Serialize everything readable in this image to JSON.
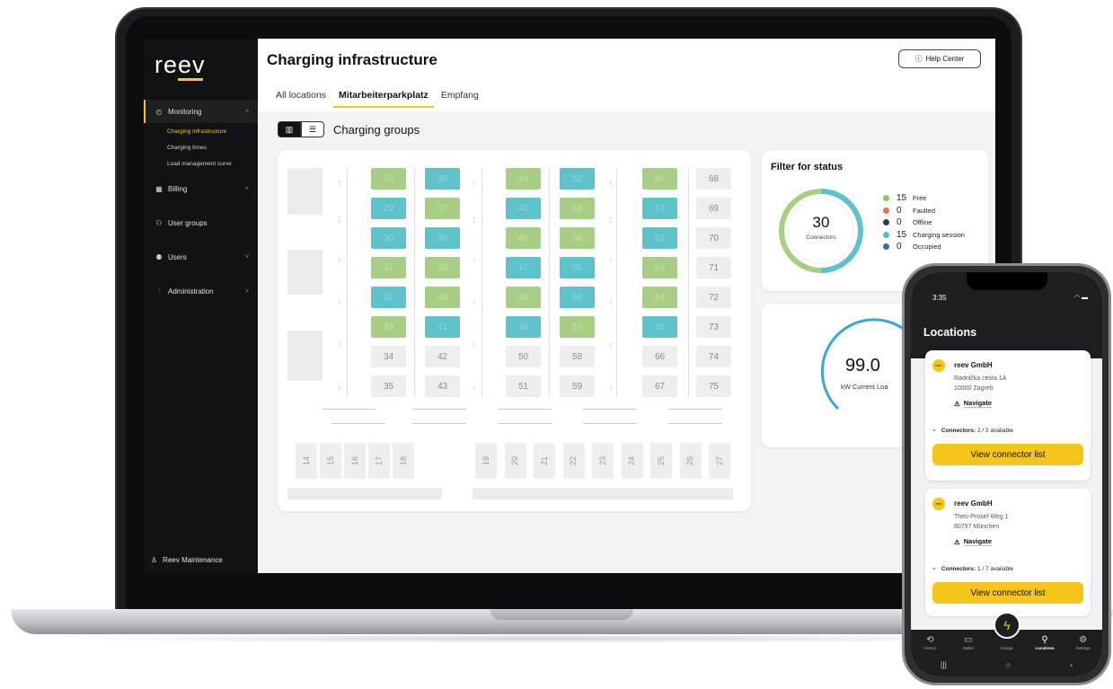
{
  "app": {
    "logo": "reev",
    "page_title": "Charging infrastructure",
    "help_button": "Help Center",
    "help_icon": "question-circle-icon"
  },
  "sidebar": {
    "items": [
      {
        "label": "Monitoring",
        "icon": "gauge-icon"
      },
      {
        "label": "Billing",
        "icon": "calculator-icon"
      },
      {
        "label": "User groups",
        "icon": "users-group-icon"
      },
      {
        "label": "Users",
        "icon": "users-icon"
      },
      {
        "label": "Administration",
        "icon": "sliders-icon"
      }
    ],
    "subitems": [
      "Charging infrastructure",
      "Charging times",
      "Load management curve"
    ],
    "user": "Reev Maintenance"
  },
  "tabs": [
    "All locations",
    "Mitarbeiterparkplatz",
    "Empfang"
  ],
  "section_title": "Charging groups",
  "map": {
    "columns": [
      {
        "slots": [
          {
            "n": "26",
            "s": "green"
          },
          {
            "n": "29",
            "s": "teal"
          },
          {
            "n": "30",
            "s": "teal"
          },
          {
            "n": "31",
            "s": "green"
          },
          {
            "n": "32",
            "s": "teal"
          },
          {
            "n": "33",
            "s": "green"
          },
          {
            "n": "34",
            "s": "gray"
          },
          {
            "n": "35",
            "s": "gray"
          }
        ]
      },
      {
        "slots": [
          {
            "n": "36",
            "s": "teal"
          },
          {
            "n": "37",
            "s": "green"
          },
          {
            "n": "38",
            "s": "teal"
          },
          {
            "n": "39",
            "s": "green"
          },
          {
            "n": "40",
            "s": "green"
          },
          {
            "n": "41",
            "s": "teal"
          },
          {
            "n": "42",
            "s": "gray"
          },
          {
            "n": "43",
            "s": "gray"
          }
        ]
      },
      {
        "slots": [
          {
            "n": "44",
            "s": "green"
          },
          {
            "n": "45",
            "s": "teal"
          },
          {
            "n": "46",
            "s": "green"
          },
          {
            "n": "47",
            "s": "teal"
          },
          {
            "n": "48",
            "s": "green"
          },
          {
            "n": "49",
            "s": "teal"
          },
          {
            "n": "50",
            "s": "gray"
          },
          {
            "n": "51",
            "s": "gray"
          }
        ]
      },
      {
        "slots": [
          {
            "n": "52",
            "s": "teal"
          },
          {
            "n": "53",
            "s": "green"
          },
          {
            "n": "54",
            "s": "green"
          },
          {
            "n": "55",
            "s": "teal"
          },
          {
            "n": "56",
            "s": "teal"
          },
          {
            "n": "57",
            "s": "green"
          },
          {
            "n": "58",
            "s": "gray"
          },
          {
            "n": "59",
            "s": "gray"
          }
        ]
      },
      {
        "slots": [
          {
            "n": "60",
            "s": "green"
          },
          {
            "n": "61",
            "s": "teal"
          },
          {
            "n": "62",
            "s": "teal"
          },
          {
            "n": "63",
            "s": "green"
          },
          {
            "n": "64",
            "s": "green"
          },
          {
            "n": "65",
            "s": "teal"
          },
          {
            "n": "66",
            "s": "gray"
          },
          {
            "n": "67",
            "s": "gray"
          }
        ]
      },
      {
        "slots": [
          {
            "n": "68",
            "s": "gray"
          },
          {
            "n": "69",
            "s": "gray"
          },
          {
            "n": "70",
            "s": "gray"
          },
          {
            "n": "71",
            "s": "gray"
          },
          {
            "n": "72",
            "s": "gray"
          },
          {
            "n": "73",
            "s": "gray"
          },
          {
            "n": "74",
            "s": "gray"
          },
          {
            "n": "75",
            "s": "gray"
          }
        ]
      }
    ],
    "bottom_left": [
      "14",
      "15",
      "16",
      "17",
      "18"
    ],
    "bottom_right": [
      "19",
      "20",
      "21",
      "22",
      "23",
      "24",
      "25",
      "26",
      "27"
    ]
  },
  "status_filter": {
    "title": "Filter for status",
    "total": "30",
    "total_label": "Connectors",
    "legend": [
      {
        "count": "15",
        "label": "Free",
        "color": "#8cc865"
      },
      {
        "count": "0",
        "label": "Faulted",
        "color": "#ee6f55"
      },
      {
        "count": "0",
        "label": "Offline",
        "color": "#2e3a4a"
      },
      {
        "count": "15",
        "label": "Charging session",
        "color": "#4fc1c9"
      },
      {
        "count": "0",
        "label": "Occupied",
        "color": "#3c6bb3"
      }
    ]
  },
  "load": {
    "value": "99.0",
    "label": "kW Current Loa"
  },
  "phone": {
    "time": "3:35",
    "title": "Locations",
    "cards": [
      {
        "name": "reev GmbH",
        "addr1": "Radnička cesta 1A",
        "addr2": "10000 Zagreb",
        "navigate": "Navigate",
        "connectors_label": "Connectors:",
        "connectors_value": "2 / 2 available",
        "button": "View connector list"
      },
      {
        "name": "reev GmbH",
        "addr1": "Theo-Prosel-Weg  1",
        "addr2": "80797 München",
        "navigate": "Navigate",
        "connectors_label": "Connectors:",
        "connectors_value": "1 / 7 available",
        "button": "View connector list"
      }
    ],
    "tabbar": [
      "History",
      "Wallet",
      "Charge",
      "Locations",
      "Settings"
    ],
    "logo_text": "reev"
  },
  "colors": {
    "accent": "#f5c518",
    "free": "#a7cf84",
    "charging": "#5ec2cb"
  }
}
